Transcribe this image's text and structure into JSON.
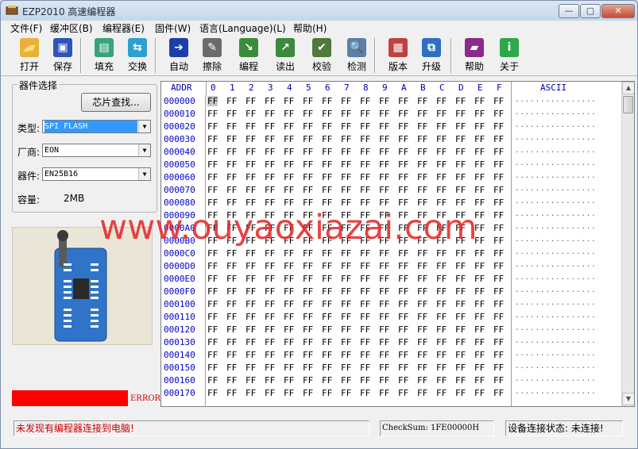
{
  "window": {
    "title": "EZP2010 高速编程器",
    "min_glyph": "—",
    "max_glyph": "▢",
    "close_glyph": "✕"
  },
  "menu": [
    "文件(F)",
    "缓冲区(B)",
    "编程器(E)",
    "固件(W)",
    "语言(Language)(L)",
    "帮助(H)"
  ],
  "toolbar": [
    {
      "label": "打开",
      "icon": "open-folder-icon",
      "glyph": "📂",
      "color": "#e8b23a"
    },
    {
      "label": "保存",
      "icon": "save-disk-icon",
      "glyph": "▣",
      "color": "#2c56b8"
    },
    {
      "label": "填充",
      "icon": "fill-icon",
      "glyph": "▤",
      "color": "#3aa37a"
    },
    {
      "label": "交换",
      "icon": "swap-icon",
      "glyph": "⇆",
      "color": "#2f9ed0"
    },
    {
      "label": "自动",
      "icon": "auto-icon",
      "glyph": "➔",
      "color": "#1b3fa8"
    },
    {
      "label": "擦除",
      "icon": "erase-icon",
      "glyph": "✎",
      "color": "#6b6b6b"
    },
    {
      "label": "编程",
      "icon": "program-icon",
      "glyph": "↘",
      "color": "#3c8a3c"
    },
    {
      "label": "读出",
      "icon": "read-icon",
      "glyph": "↗",
      "color": "#3c8a3c"
    },
    {
      "label": "校验",
      "icon": "verify-icon",
      "glyph": "✔",
      "color": "#4f7a3a"
    },
    {
      "label": "检测",
      "icon": "detect-icon",
      "glyph": "🔍",
      "color": "#5a7fa8"
    },
    {
      "label": "版本",
      "icon": "version-icon",
      "glyph": "▦",
      "color": "#c04040"
    },
    {
      "label": "升级",
      "icon": "upgrade-icon",
      "glyph": "⧉",
      "color": "#2f6fc0"
    },
    {
      "label": "帮助",
      "icon": "help-book-icon",
      "glyph": "▰",
      "color": "#8a2a8a"
    },
    {
      "label": "关于",
      "icon": "about-info-icon",
      "glyph": "i",
      "color": "#2ea84a"
    }
  ],
  "device_select": {
    "group_title": "器件选择",
    "chip_search_label": "芯片查找...",
    "type_label": "类型:",
    "type_value": "SPI FLASH",
    "vendor_label": "厂商:",
    "vendor_value": "EON",
    "device_label": "器件:",
    "device_value": "EN25B16",
    "capacity_label": "容量:",
    "capacity_value": "2MB",
    "combo_arrow": "▼"
  },
  "error_label": "ERROR",
  "hex": {
    "addr_header": "ADDR",
    "col_headers": [
      "0",
      "1",
      "2",
      "3",
      "4",
      "5",
      "6",
      "7",
      "8",
      "9",
      "A",
      "B",
      "C",
      "D",
      "E",
      "F"
    ],
    "ascii_header": "ASCII",
    "rows": [
      "000000",
      "000010",
      "000020",
      "000030",
      "000040",
      "000050",
      "000060",
      "000070",
      "000080",
      "000090",
      "0000A0",
      "0000B0",
      "0000C0",
      "0000D0",
      "0000E0",
      "0000F0",
      "000100",
      "000110",
      "000120",
      "000130",
      "000140",
      "000150",
      "000160",
      "000170"
    ],
    "fill_byte": "FF",
    "ascii_row": "................"
  },
  "status": {
    "message": "未发现有编程器连接到电脑!",
    "checksum": "CheckSum: 1FE00000H",
    "connection": "设备连接状态: 未连接!"
  },
  "watermark": "www.ouyaoxiazai.com",
  "scroll": {
    "up": "▲",
    "down": "▼"
  }
}
